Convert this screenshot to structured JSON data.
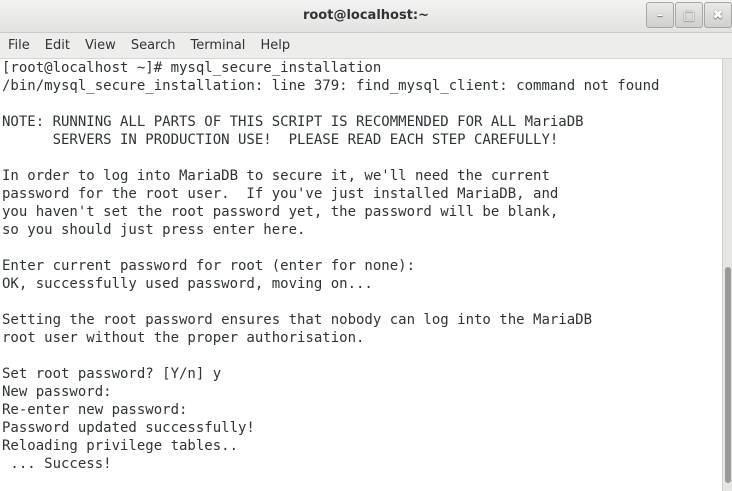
{
  "window": {
    "title": "root@localhost:~",
    "buttons": {
      "minimize": "–",
      "maximize": "□",
      "close": "✖"
    }
  },
  "menubar": {
    "items": [
      {
        "label": "File"
      },
      {
        "label": "Edit"
      },
      {
        "label": "View"
      },
      {
        "label": "Search"
      },
      {
        "label": "Terminal"
      },
      {
        "label": "Help"
      }
    ]
  },
  "terminal": {
    "lines": [
      "[root@localhost ~]# mysql_secure_installation",
      "/bin/mysql_secure_installation: line 379: find_mysql_client: command not found",
      "",
      "NOTE: RUNNING ALL PARTS OF THIS SCRIPT IS RECOMMENDED FOR ALL MariaDB",
      "      SERVERS IN PRODUCTION USE!  PLEASE READ EACH STEP CAREFULLY!",
      "",
      "In order to log into MariaDB to secure it, we'll need the current",
      "password for the root user.  If you've just installed MariaDB, and",
      "you haven't set the root password yet, the password will be blank,",
      "so you should just press enter here.",
      "",
      "Enter current password for root (enter for none):",
      "OK, successfully used password, moving on...",
      "",
      "Setting the root password ensures that nobody can log into the MariaDB",
      "root user without the proper authorisation.",
      "",
      "Set root password? [Y/n] y",
      "New password:",
      "Re-enter new password:",
      "Password updated successfully!",
      "Reloading privilege tables..",
      " ... Success!"
    ]
  },
  "colors": {
    "terminal_bg": "#ffffff",
    "terminal_fg": "#2e3436",
    "titlebar": "#e8e8e6"
  }
}
